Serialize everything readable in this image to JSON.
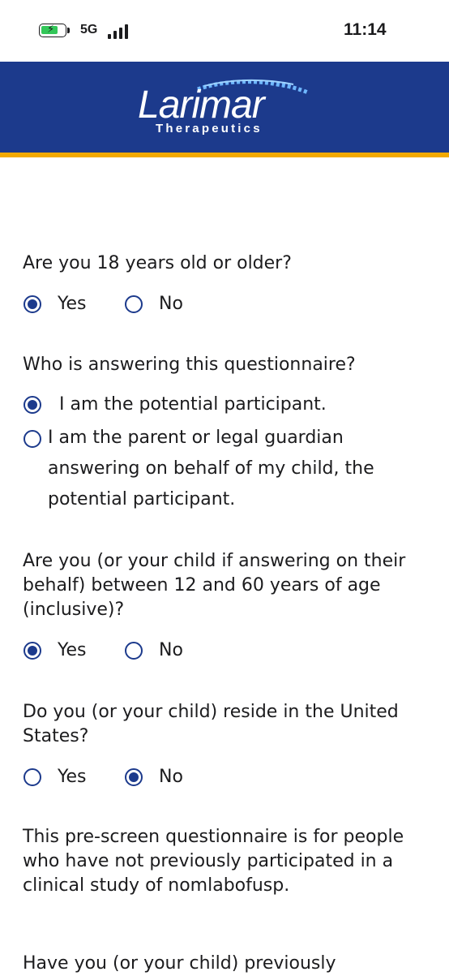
{
  "status_bar": {
    "network": "5G",
    "time": "11:14"
  },
  "brand": {
    "name": "Larimar",
    "subtitle": "Therapeutics",
    "accent": "#f2a900",
    "primary": "#1c3a8c"
  },
  "form": {
    "q1": {
      "text": "Are you 18 years old or older?",
      "options": [
        "Yes",
        "No"
      ],
      "selected": "Yes"
    },
    "q2": {
      "text": "Who is answering this questionnaire?",
      "options": [
        "I am the potential participant.",
        "I am the parent or legal guardian answering on behalf of my child, the potential participant."
      ],
      "selected": "I am the potential participant."
    },
    "q3": {
      "text": "Are you (or your child if answering on their behalf) between 12 and 60 years of age (inclusive)?",
      "options": [
        "Yes",
        "No"
      ],
      "selected": "Yes"
    },
    "q4": {
      "text": "Do you (or your child) reside in the United States?",
      "options": [
        "Yes",
        "No"
      ],
      "selected": "No"
    },
    "info": "This pre-screen questionnaire is for people who have not previously participated in a clinical study of nomlabofusp.",
    "q5_partial": "Have you (or your child) previously"
  }
}
